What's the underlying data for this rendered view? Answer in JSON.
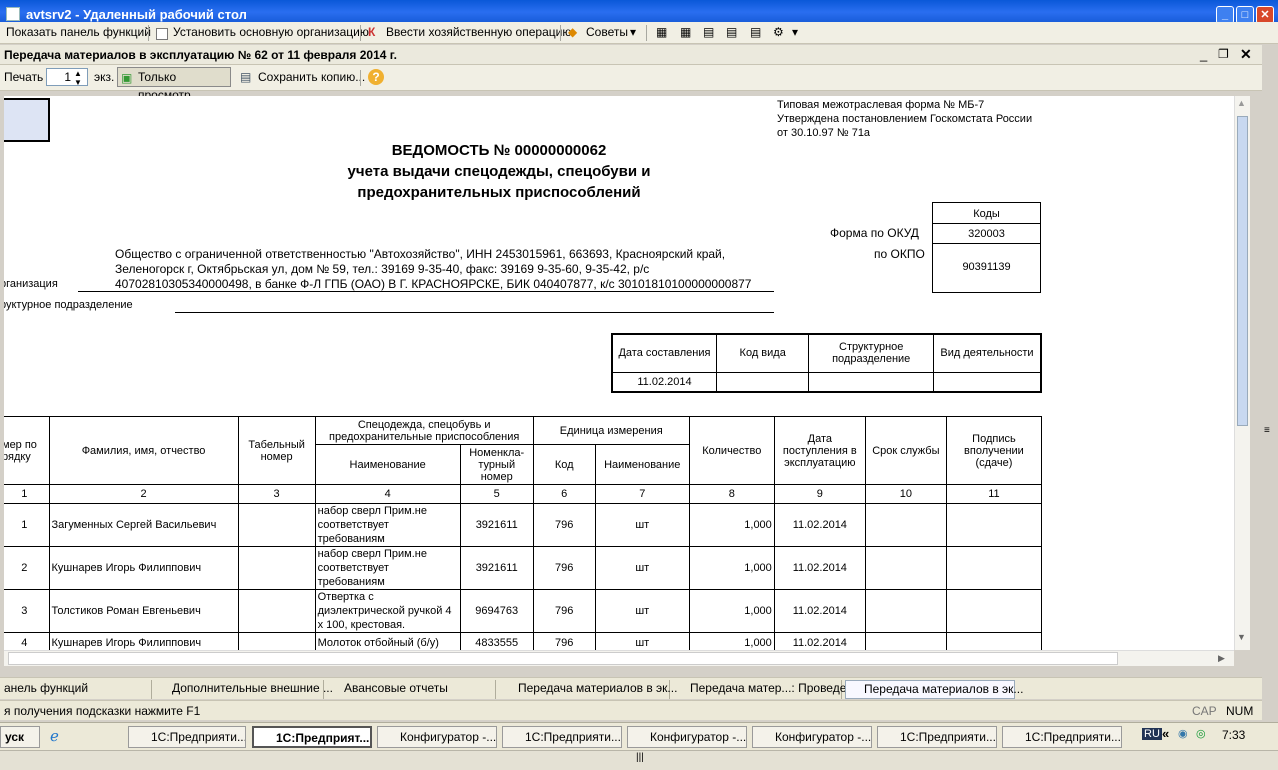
{
  "window": {
    "title": "avtsrv2 - Удаленный рабочий стол",
    "min": "_",
    "max": "□",
    "close": "✕"
  },
  "toolbar": {
    "show_panel": "Показать панель функций",
    "set_org": "Установить основную организацию",
    "enter_op": "Ввести хозяйственную операцию",
    "tips": "Советы"
  },
  "doc": {
    "title": "Передача материалов в эксплуатацию № 62 от 11 февраля 2014 г."
  },
  "print_bar": {
    "print": "Печать",
    "copies": "1",
    "copies_unit": "экз.",
    "view_only": "Только просмотр",
    "save_copy": "Сохранить копию...",
    "help": "?"
  },
  "form": {
    "standard_form": "Типовая межотраслевая форма № МБ-7",
    "approved": "Утверждена постановлением Госкомстата России",
    "approved_date": "от 30.10.97 № 71а",
    "heading1": "ВЕДОМОСТЬ № 00000000062",
    "heading2": "учета выдачи спецодежды, спецобуви и",
    "heading3": "предохранительных приспособлений",
    "codes_label": "Коды",
    "okud_label": "Форма по ОКУД",
    "okud": "320003",
    "okpo_label": "по ОКПО",
    "okpo": "90391139",
    "org_line1": "Общество с ограниченной ответственностью \"Автохозяйство\", ИНН 2453015961, 663693, Красноярский край,",
    "org_line2": "Зеленогорск г, Октябрьская ул, дом № 59, тел.: 39169 9-35-40, факс: 39169 9-35-60, 9-35-42, р/с",
    "org_line3": "40702810305340000498, в банке Ф-Л ГПБ (ОАО) В Г. КРАСНОЯРСКЕ, БИК 040407877, к/с 30101810100000000877",
    "org_label": "рганизация",
    "dept_label": "руктурное подразделение",
    "hdr": {
      "date_comp": "Дата составления",
      "code_type": "Код вида",
      "struct": "Структурное подразделение",
      "activity": "Вид деятельности",
      "date_val": "11.02.2014"
    }
  },
  "table": {
    "h_num": "мер по рядку",
    "h_name": "Фамилия, имя, отчество",
    "h_tab": "Табельный номер",
    "h_spec": "Спецодежда, спецобувь и предохранительные приспособления",
    "h_spec_name": "Наименование",
    "h_spec_nom": "Номенкла-турный номер",
    "h_unit": "Единица измерения",
    "h_unit_code": "Код",
    "h_unit_name": "Наименование",
    "h_qty": "Количество",
    "h_date": "Дата поступления в эксплуатацию",
    "h_life": "Срок службы",
    "h_sign": "Подпись вполучении (сдаче)",
    "nums": [
      "1",
      "2",
      "3",
      "4",
      "5",
      "6",
      "7",
      "8",
      "9",
      "10",
      "11"
    ],
    "rows": [
      {
        "n": "1",
        "name": "Загуменных Сергей Васильевич",
        "item": "набор сверл Прим.не соответствует требованиям",
        "nom": "3921611",
        "code": "796",
        "unit": "шт",
        "qty": "1,000",
        "date": "11.02.2014"
      },
      {
        "n": "2",
        "name": "Кушнарев Игорь Филиппович",
        "item": "набор сверл Прим.не соответствует требованиям",
        "nom": "3921611",
        "code": "796",
        "unit": "шт",
        "qty": "1,000",
        "date": "11.02.2014"
      },
      {
        "n": "3",
        "name": "Толстиков Роман Евгеньевич",
        "item": "Отвертка с диэлектрической ручкой 4 х 100, крестовая.",
        "nom": "9694763",
        "code": "796",
        "unit": "шт",
        "qty": "1,000",
        "date": "11.02.2014"
      },
      {
        "n": "4",
        "name": "Кушнарев Игорь Филиппович",
        "item": "Молоток отбойный (б/у)",
        "nom": "4833555",
        "code": "796",
        "unit": "шт",
        "qty": "1,000",
        "date": "11.02.2014"
      }
    ]
  },
  "tabs": [
    "анель функций",
    "Дополнительные внешние ...",
    "Авансовые отчеты",
    "Передача материалов в эк...",
    "Передача матер...: Проведен",
    "Передача материалов в эк..."
  ],
  "status": {
    "hint": "я получения подсказки нажмите F1",
    "cap": "CAP",
    "num": "NUM"
  },
  "taskbar": {
    "start": "уск",
    "items": [
      "1С:Предприяти...",
      "1С:Предприят...",
      "Конфигуратор -...",
      "1С:Предприяти...",
      "Конфигуратор -...",
      "Конфигуратор -...",
      "1С:Предприяти...",
      "1С:Предприяти..."
    ],
    "lang": "RU",
    "time": "7:33"
  }
}
